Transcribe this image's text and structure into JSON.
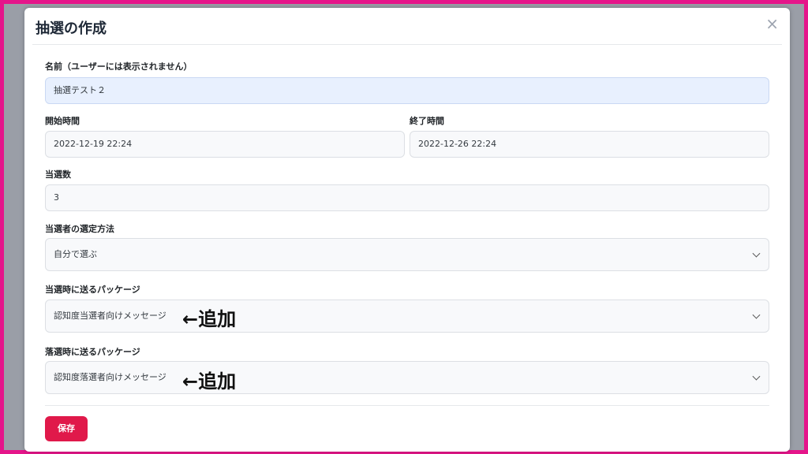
{
  "modal": {
    "title": "抽選の作成",
    "close_symbol": "×",
    "save_label": "保存"
  },
  "form": {
    "name": {
      "label": "名前（ユーザーには表示されません）",
      "value": "抽選テスト２"
    },
    "start_time": {
      "label": "開始時間",
      "value": "2022-12-19 22:24"
    },
    "end_time": {
      "label": "終了時間",
      "value": "2022-12-26 22:24"
    },
    "winner_count": {
      "label": "当選数",
      "value": "3"
    },
    "selection_method": {
      "label": "当選者の選定方法",
      "value": "自分で選ぶ"
    },
    "winner_package": {
      "label": "当選時に送るパッケージ",
      "value": "認知度当選者向けメッセージ"
    },
    "loser_package": {
      "label": "落選時に送るパッケージ",
      "value": "認知度落選者向けメッセージ"
    }
  },
  "annotations": {
    "winner_note": "←追加",
    "loser_note": "←追加"
  },
  "colors": {
    "frame_border": "#e5158a",
    "save_button": "#e0194a",
    "autofill_background": "#e8f0fe"
  },
  "icons": [
    "close-icon",
    "chevron-down-icon"
  ]
}
